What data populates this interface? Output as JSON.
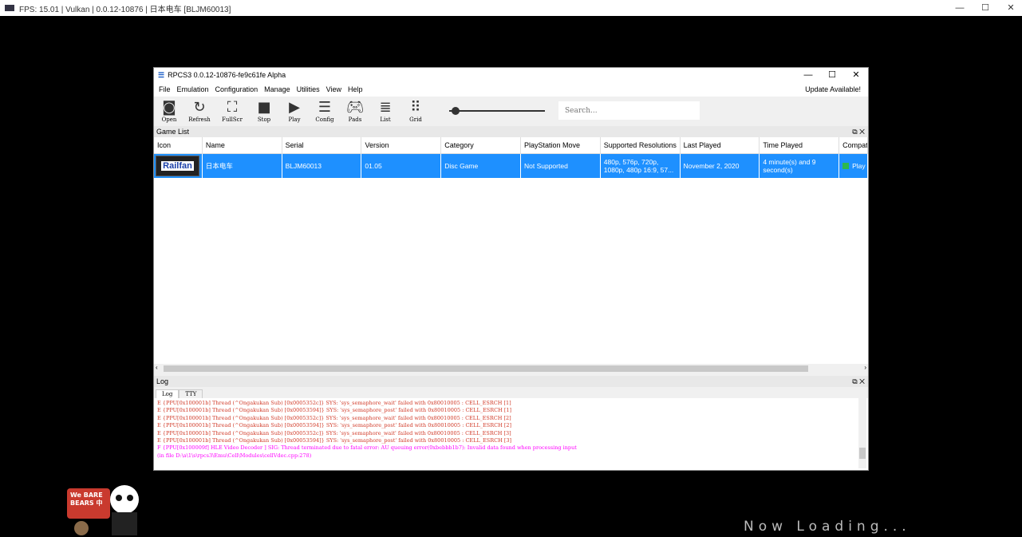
{
  "outer_title": "FPS: 15.01 | Vulkan | 0.0.12-10876 | 日本电车 [BLJM60013]",
  "window_title": "RPCS3 0.0.12-10876-fe9c61fe Alpha",
  "menu": [
    "File",
    "Emulation",
    "Configuration",
    "Manage",
    "Utilities",
    "View",
    "Help"
  ],
  "update": "Update Available!",
  "toolbar": [
    {
      "label": "Open",
      "icon": "folder-icon"
    },
    {
      "label": "Refresh",
      "icon": "refresh-icon"
    },
    {
      "label": "FullScr",
      "icon": "fullscreen-icon"
    },
    {
      "label": "Stop",
      "icon": "stop-icon"
    },
    {
      "label": "Play",
      "icon": "play-icon"
    },
    {
      "label": "Config",
      "icon": "config-icon"
    },
    {
      "label": "Pads",
      "icon": "gamepad-icon"
    },
    {
      "label": "List",
      "icon": "list-icon"
    },
    {
      "label": "Grid",
      "icon": "grid-icon"
    }
  ],
  "search_placeholder": "Search...",
  "game_list_title": "Game List",
  "columns": [
    "Icon",
    "Name",
    "Serial",
    "Version",
    "Category",
    "PlayStation Move",
    "Supported Resolutions",
    "Last Played",
    "Time Played",
    "Compat"
  ],
  "row": {
    "icon_text": "Railfan",
    "name": "日本电车",
    "serial": "BLJM60013",
    "version": "01.05",
    "category": "Disc Game",
    "move": "Not Supported",
    "resolutions": "480p, 576p, 720p, 1080p, 480p 16:9, 57...",
    "last_played": "November 2, 2020",
    "time_played": "4 minute(s) and 9 second(s)",
    "compat": "Play"
  },
  "log_title": "Log",
  "log_tabs": [
    "Log",
    "TTY"
  ],
  "log_lines": [
    {
      "level": "e",
      "text": "E {PPU[0x100001b] Thread (^Ongakukan Sub) [0x0005352c]} SYS: 'sys_semaphore_wait' failed with 0x80010005 : CELL_ESRCH [1]"
    },
    {
      "level": "e",
      "text": "E {PPU[0x100001b] Thread (^Ongakukan Sub) [0x00053594]} SYS: 'sys_semaphore_post' failed with 0x80010005 : CELL_ESRCH [1]"
    },
    {
      "level": "e",
      "text": "E {PPU[0x100001b] Thread (^Ongakukan Sub) [0x0005352c]} SYS: 'sys_semaphore_wait' failed with 0x80010005 : CELL_ESRCH [2]"
    },
    {
      "level": "e",
      "text": "E {PPU[0x100001b] Thread (^Ongakukan Sub) [0x00053594]} SYS: 'sys_semaphore_post' failed with 0x80010005 : CELL_ESRCH [2]"
    },
    {
      "level": "e",
      "text": "E {PPU[0x100001b] Thread (^Ongakukan Sub) [0x0005352c]} SYS: 'sys_semaphore_wait' failed with 0x80010005 : CELL_ESRCH [3]"
    },
    {
      "level": "e",
      "text": "E {PPU[0x100001b] Thread (^Ongakukan Sub) [0x00053594]} SYS: 'sys_semaphore_post' failed with 0x80010005 : CELL_ESRCH [3]"
    },
    {
      "level": "f",
      "text": "F {PPU[0x100009f] HLE Video Decoder ] SIG: Thread terminated due to fatal error: AU queuing error(0xbebbb1b7): Invalid data found when processing input"
    },
    {
      "level": "f",
      "text": "(in file D:\\a\\1\\s\\rpcs3\\Emu\\Cell\\Modules\\cellVdec.cpp:278)"
    }
  ],
  "sticker_text": "We BARE BEARS 中",
  "loading": "Now Loading..."
}
